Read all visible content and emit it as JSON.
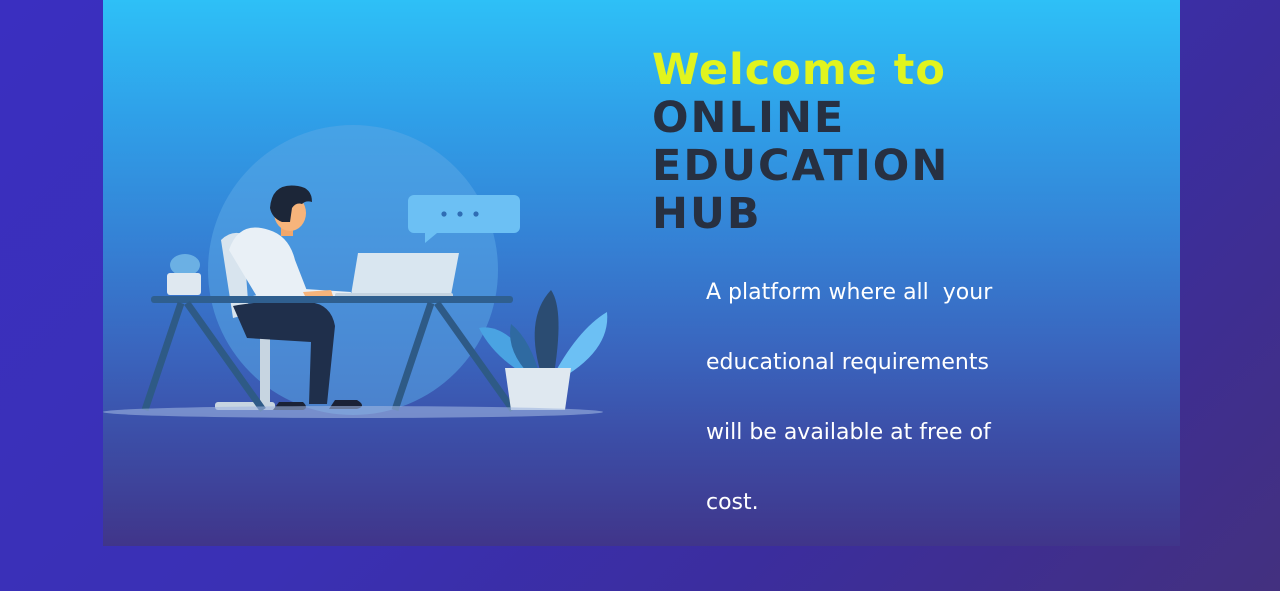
{
  "hero": {
    "welcome": "Welcome to",
    "headline": [
      "ONLINE",
      "EDUCATION",
      "HUB"
    ],
    "tagline": [
      "A platform where all  your",
      "educational requirements",
      "will be available at free of",
      "cost."
    ]
  },
  "illustration": {
    "description_icon": "person-at-laptop-illustration",
    "chat_bubble_icon": "chat-bubble-icon",
    "plant_icon": "potted-plant-icon",
    "cactus_icon": "cactus-pot-icon"
  },
  "colors": {
    "welcome": "#e1f41e",
    "headline": "#273041",
    "tagline": "#ffffff",
    "banner_top": "#2ec0f7",
    "banner_bottom": "#40358a",
    "page_background": "#3a2fc0"
  }
}
